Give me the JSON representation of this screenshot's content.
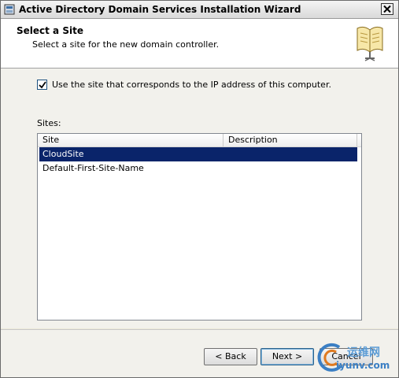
{
  "window": {
    "title": "Active Directory Domain Services Installation Wizard"
  },
  "header": {
    "title": "Select a Site",
    "subtitle": "Select a site for the new domain controller."
  },
  "options": {
    "use_ip_site_label": "Use the site that corresponds to the IP address of this computer.",
    "use_ip_site_checked": true
  },
  "sites": {
    "label": "Sites:",
    "columns": [
      "Site",
      "Description"
    ],
    "rows": [
      {
        "site": "CloudSite",
        "description": "",
        "selected": true
      },
      {
        "site": "Default-First-Site-Name",
        "description": "",
        "selected": false
      }
    ]
  },
  "buttons": {
    "back": "< Back",
    "next": "Next >",
    "cancel": "Cancel"
  },
  "watermark": {
    "line1": "运维网",
    "line2": "iyunv.com"
  },
  "colors": {
    "selection": "#0a246a",
    "accent": "#3b7fc4"
  }
}
